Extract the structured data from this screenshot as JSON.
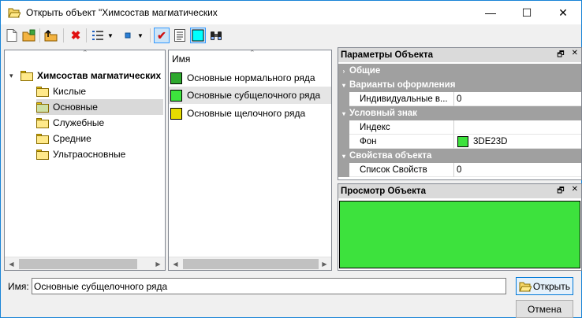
{
  "window": {
    "title": "Открыть объект \"Химсостав магматических",
    "min_glyph": "—",
    "max_glyph": "☐",
    "close_glyph": "✕"
  },
  "toolbar": {
    "icons": [
      "new-document-icon",
      "open-folder-icon",
      "move-up-icon",
      "delete-icon",
      "view-list-icon",
      "view-dropdown-icon",
      "item-style-icon",
      "item-style-dropdown-icon",
      "check-icon",
      "properties-icon",
      "preview-toggle-icon",
      "search-binoculars-icon"
    ],
    "delete_glyph": "✖",
    "check_glyph": "✔",
    "binoculars_glyph": "⌘",
    "dropdown_glyph": "▼",
    "colors": {
      "delete": "#e01010",
      "check": "#d01010",
      "preview": "#00ffff"
    }
  },
  "tree": {
    "sort_glyph": "⌃",
    "expander_glyph": "▾",
    "root": "Химсостав магматических",
    "items": [
      "Кислые",
      "Основные",
      "Служебные",
      "Средние",
      "Ультраосновные"
    ],
    "selected": "Основные"
  },
  "list": {
    "sort_glyph": "⌃",
    "header": "Имя",
    "items": [
      {
        "label": "Основные нормального ряда",
        "color": "#2ea82e"
      },
      {
        "label": "Основные субщелочного ряда",
        "color": "#3de23d"
      },
      {
        "label": "Основные щелочного ряда",
        "color": "#e6dc00"
      }
    ],
    "selected": "Основные субщелочного ряда"
  },
  "scroll": {
    "left_glyph": "◀",
    "right_glyph": "▶"
  },
  "properties": {
    "title": "Параметры Объекта",
    "pin_glyph": "🗗",
    "close_glyph": "✕",
    "collapsed_glyph": "›",
    "expanded_glyph": "▾",
    "categories": {
      "general": "Общие",
      "design": "Варианты оформления",
      "symbol": "Условный знак",
      "object_props": "Свойства объекта"
    },
    "rows": {
      "individual": {
        "name": "Индивидуальные в...",
        "value": "0"
      },
      "index": {
        "name": "Индекс",
        "value": ""
      },
      "background": {
        "name": "Фон",
        "value": "3DE23D",
        "color": "#3de23d"
      },
      "props_list": {
        "name": "Список Свойств",
        "value": "0"
      }
    }
  },
  "preview": {
    "title": "Просмотр Объекта",
    "fill": "#3de23d"
  },
  "bottom": {
    "name_label": "Имя:",
    "name_value": "Основные субщелочного ряда",
    "open_label": "Открыть",
    "cancel_label": "Отмена"
  }
}
